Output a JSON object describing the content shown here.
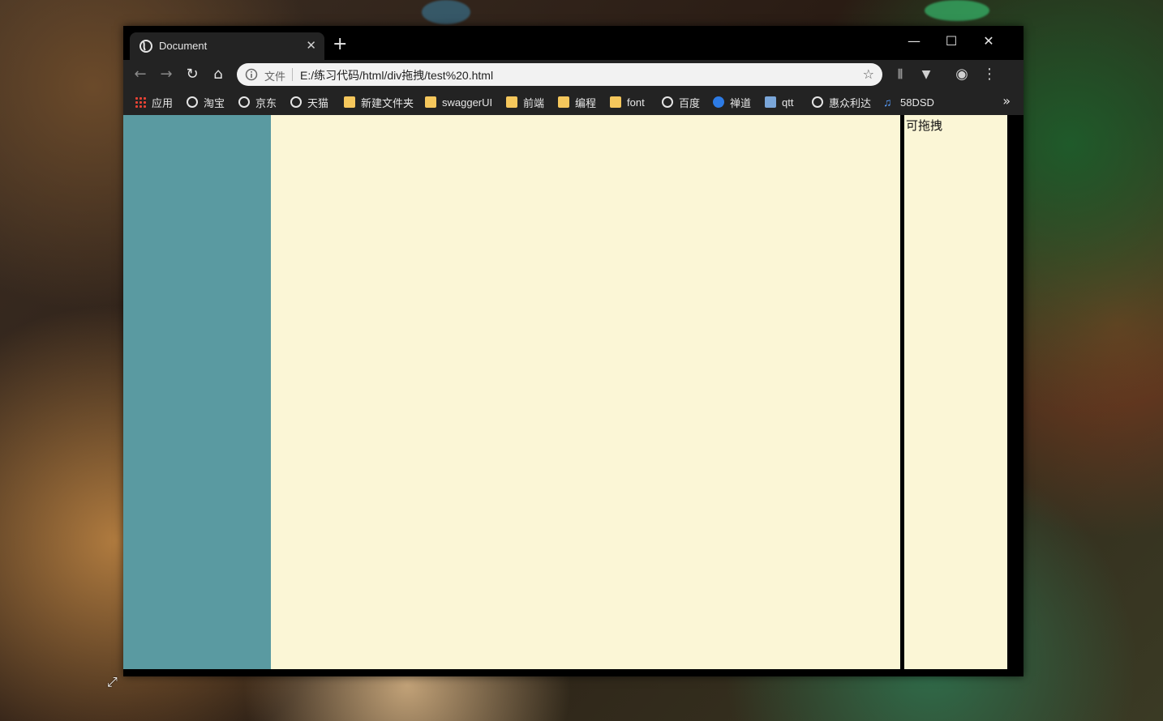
{
  "tab": {
    "title": "Document",
    "close": "✕",
    "new_tab": "+"
  },
  "window_controls": {
    "minimize": "—",
    "maximize": "☐",
    "close": "✕"
  },
  "toolbar": {
    "back": "←",
    "forward": "→",
    "reload": "↻",
    "home": "⌂",
    "address": {
      "scheme_label": "文件",
      "url": "E:/练习代码/html/div拖拽/test%20.html"
    },
    "star": "☆",
    "ext1": "⫼",
    "ext2": "▼",
    "profile": "◉",
    "menu": "⋮"
  },
  "bookmarks": {
    "items": [
      {
        "label": "应用",
        "icon": "apps-icon"
      },
      {
        "label": "淘宝",
        "icon": "globe-icon"
      },
      {
        "label": "京东",
        "icon": "globe-icon"
      },
      {
        "label": "天猫",
        "icon": "globe-icon"
      },
      {
        "label": "新建文件夹",
        "icon": "folder-icon"
      },
      {
        "label": "swaggerUI",
        "icon": "folder-icon"
      },
      {
        "label": "前端",
        "icon": "folder-icon"
      },
      {
        "label": "编程",
        "icon": "folder-icon"
      },
      {
        "label": "font",
        "icon": "folder-icon"
      },
      {
        "label": "百度",
        "icon": "globe-icon"
      },
      {
        "label": "禅道",
        "icon": "zentao-icon"
      },
      {
        "label": "qtt",
        "icon": "qtt-icon"
      },
      {
        "label": "惠众利达",
        "icon": "globe-icon"
      },
      {
        "label": "58DSD",
        "icon": "music-note-icon"
      }
    ],
    "more": "»"
  },
  "page": {
    "right_pane_label": "可拖拽"
  },
  "colors": {
    "left_pane": "#5a9aa1",
    "content_bg": "#fbf6d6",
    "divider": "#000000"
  }
}
